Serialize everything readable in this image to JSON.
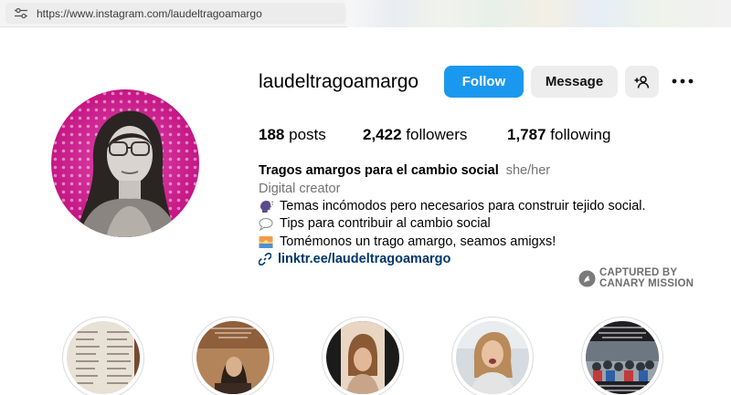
{
  "browser": {
    "url": "https://www.instagram.com/laudeltragoamargo",
    "site_info_icon": "tune-icon"
  },
  "profile": {
    "username": "laudeltragoamargo",
    "follow_label": "Follow",
    "message_label": "Message",
    "add_user_icon": "person-add-icon",
    "more_icon": "more-horizontal-icon",
    "stats": {
      "posts_count": "188",
      "posts_label": "posts",
      "followers_count": "2,422",
      "followers_label": "followers",
      "following_count": "1,787",
      "following_label": "following"
    },
    "bio": {
      "name": "Tragos amargos para el cambio social",
      "pronouns": "she/her",
      "category": "Digital creator",
      "lines": [
        {
          "icon": "speaking-head-icon",
          "text": "Temas incómodos pero necesarios para construir tejido social."
        },
        {
          "icon": "speech-bubble-icon",
          "text": "Tips para contribuir al cambio social"
        },
        {
          "icon": "sunrise-icon",
          "text": "Tomémonos un trago amargo, seamos amigxs!"
        }
      ],
      "link_icon": "link-icon",
      "link": "linktr.ee/laudeltragoamargo"
    }
  },
  "watermark": {
    "line1": "CAPTURED BY",
    "line2": "CANARY MISSION"
  },
  "highlights": [
    {
      "icon": "highlight-handwritten-notes"
    },
    {
      "icon": "highlight-woman-video"
    },
    {
      "icon": "highlight-woman-speaking"
    },
    {
      "icon": "highlight-woman-outdoors"
    },
    {
      "icon": "highlight-protest-march"
    }
  ],
  "colors": {
    "follow_button": "#1a98f0",
    "secondary_button": "#ededed",
    "link": "#00376b",
    "muted_text": "#737373",
    "avatar_accent": "#d9289a"
  }
}
